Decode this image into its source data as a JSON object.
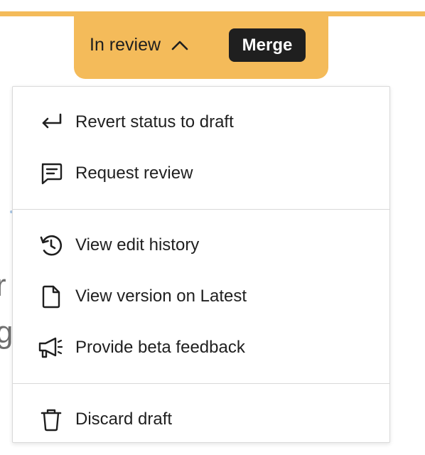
{
  "header": {
    "status_label": "In review",
    "merge_label": "Merge",
    "accent_color": "#f4bb5a"
  },
  "background": {
    "line1": "r",
    "line2": "g"
  },
  "menu": {
    "groups": [
      {
        "items": [
          {
            "label": "Revert status to draft",
            "icon": "return-arrow-icon"
          },
          {
            "label": "Request review",
            "icon": "comment-icon"
          }
        ]
      },
      {
        "items": [
          {
            "label": "View edit history",
            "icon": "history-icon"
          },
          {
            "label": "View version on Latest",
            "icon": "document-icon"
          },
          {
            "label": "Provide beta feedback",
            "icon": "megaphone-icon"
          }
        ]
      },
      {
        "items": [
          {
            "label": "Discard draft",
            "icon": "trash-icon"
          }
        ]
      }
    ]
  }
}
